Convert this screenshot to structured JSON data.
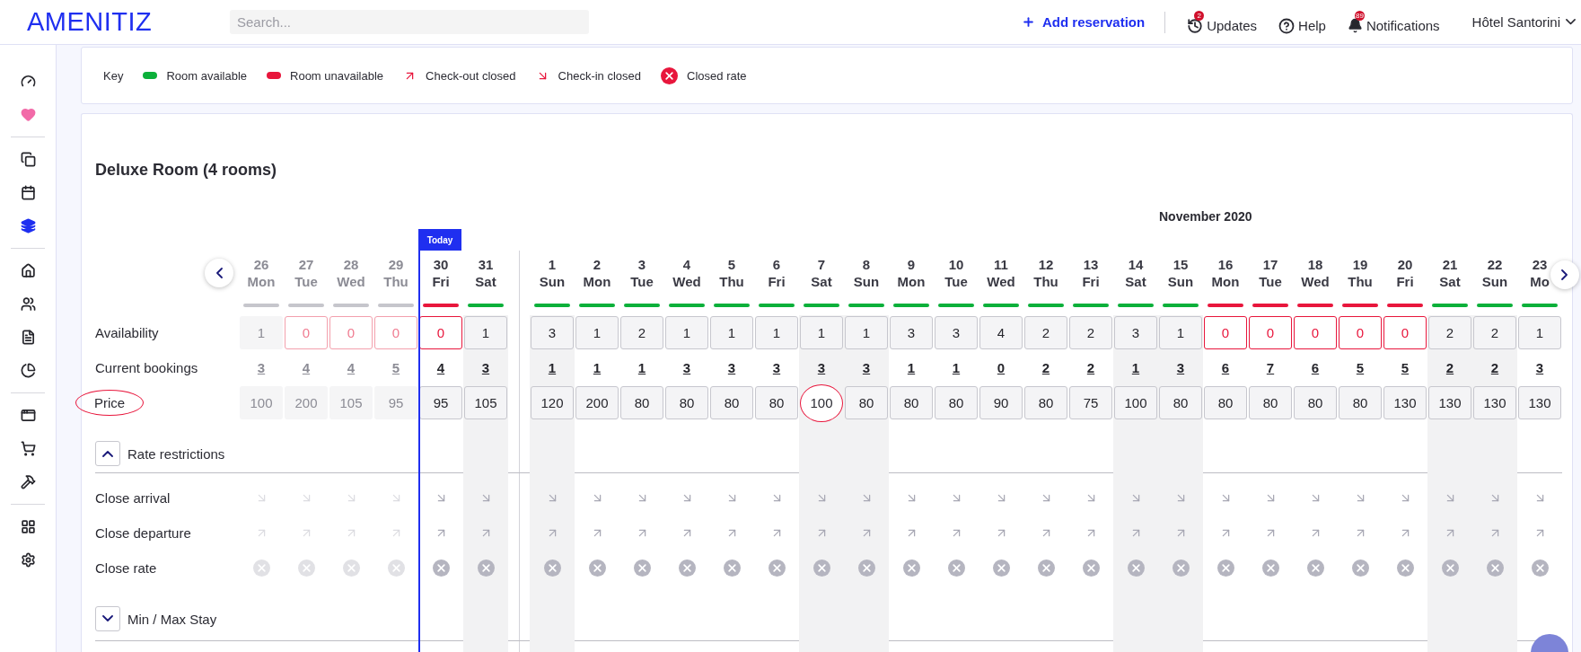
{
  "header": {
    "logo": "AMENITIZ",
    "search": {
      "placeholder": "Search..."
    },
    "add_reservation": "Add reservation",
    "nav": [
      {
        "kind": "updates",
        "label": "Updates",
        "badge": "2"
      },
      {
        "kind": "help",
        "label": "Help"
      },
      {
        "kind": "notifications",
        "label": "Notifications",
        "badge": "89"
      }
    ],
    "hotel": "Hôtel Santorini"
  },
  "sidebar": {
    "groups": [
      [
        {
          "kind": "dashboard",
          "selected": false
        },
        {
          "kind": "heart",
          "selected": false
        }
      ],
      [
        {
          "kind": "copy",
          "selected": false
        },
        {
          "kind": "calendar",
          "selected": false
        },
        {
          "kind": "layers",
          "selected": true
        }
      ],
      [
        {
          "kind": "home",
          "selected": false
        },
        {
          "kind": "users",
          "selected": false
        },
        {
          "kind": "file",
          "selected": false
        },
        {
          "kind": "pie",
          "selected": false
        }
      ],
      [
        {
          "kind": "window",
          "selected": false
        },
        {
          "kind": "cart",
          "selected": false
        },
        {
          "kind": "tool",
          "selected": false
        }
      ],
      [
        {
          "kind": "apps",
          "selected": false
        },
        {
          "kind": "settings",
          "selected": false
        }
      ]
    ]
  },
  "key": {
    "title": "Key",
    "items": [
      {
        "kind": "available",
        "label": "Room available"
      },
      {
        "kind": "unavailable",
        "label": "Room unavailable"
      },
      {
        "kind": "checkout",
        "label": "Check-out closed"
      },
      {
        "kind": "checkin",
        "label": "Check-in closed"
      },
      {
        "kind": "closed_rate",
        "label": "Closed rate"
      }
    ]
  },
  "room": {
    "title": "Deluxe Room (4 rooms)",
    "month": "November 2020",
    "today_label": "Today",
    "row_labels": {
      "availability": "Availability",
      "bookings": "Current bookings",
      "price": {
        "label": "Price",
        "circled": true
      }
    },
    "days": [
      {
        "date": "26",
        "weekday": "Mon",
        "past": true,
        "today": false,
        "weekend": false,
        "month_start": false,
        "available": true,
        "availability": "1",
        "bookings": "3",
        "price": "100",
        "price_circled": false
      },
      {
        "date": "27",
        "weekday": "Tue",
        "past": true,
        "today": false,
        "weekend": false,
        "month_start": false,
        "available": false,
        "availability": "0",
        "bookings": "4",
        "price": "200",
        "price_circled": false
      },
      {
        "date": "28",
        "weekday": "Wed",
        "past": true,
        "today": false,
        "weekend": false,
        "month_start": false,
        "available": false,
        "availability": "0",
        "bookings": "4",
        "price": "105",
        "price_circled": false
      },
      {
        "date": "29",
        "weekday": "Thu",
        "past": true,
        "today": false,
        "weekend": false,
        "month_start": false,
        "available": false,
        "availability": "0",
        "bookings": "5",
        "price": "95",
        "price_circled": false
      },
      {
        "date": "30",
        "weekday": "Fri",
        "past": false,
        "today": true,
        "weekend": false,
        "month_start": false,
        "available": false,
        "availability": "0",
        "bookings": "4",
        "price": "95",
        "price_circled": false
      },
      {
        "date": "31",
        "weekday": "Sat",
        "past": false,
        "today": false,
        "weekend": true,
        "month_start": false,
        "available": true,
        "availability": "1",
        "bookings": "3",
        "price": "105",
        "price_circled": false
      },
      {
        "date": "1",
        "weekday": "Sun",
        "past": false,
        "today": false,
        "weekend": true,
        "month_start": true,
        "available": true,
        "availability": "3",
        "bookings": "1",
        "price": "120",
        "price_circled": false
      },
      {
        "date": "2",
        "weekday": "Mon",
        "past": false,
        "today": false,
        "weekend": false,
        "month_start": false,
        "available": true,
        "availability": "1",
        "bookings": "1",
        "price": "200",
        "price_circled": false
      },
      {
        "date": "3",
        "weekday": "Tue",
        "past": false,
        "today": false,
        "weekend": false,
        "month_start": false,
        "available": true,
        "availability": "2",
        "bookings": "1",
        "price": "80",
        "price_circled": false
      },
      {
        "date": "4",
        "weekday": "Wed",
        "past": false,
        "today": false,
        "weekend": false,
        "month_start": false,
        "available": true,
        "availability": "1",
        "bookings": "3",
        "price": "80",
        "price_circled": false
      },
      {
        "date": "5",
        "weekday": "Thu",
        "past": false,
        "today": false,
        "weekend": false,
        "month_start": false,
        "available": true,
        "availability": "1",
        "bookings": "3",
        "price": "80",
        "price_circled": false
      },
      {
        "date": "6",
        "weekday": "Fri",
        "past": false,
        "today": false,
        "weekend": false,
        "month_start": false,
        "available": true,
        "availability": "1",
        "bookings": "3",
        "price": "80",
        "price_circled": false
      },
      {
        "date": "7",
        "weekday": "Sat",
        "past": false,
        "today": false,
        "weekend": true,
        "month_start": false,
        "available": true,
        "availability": "1",
        "bookings": "3",
        "price": "100",
        "price_circled": true
      },
      {
        "date": "8",
        "weekday": "Sun",
        "past": false,
        "today": false,
        "weekend": true,
        "month_start": false,
        "available": true,
        "availability": "1",
        "bookings": "3",
        "price": "80",
        "price_circled": false
      },
      {
        "date": "9",
        "weekday": "Mon",
        "past": false,
        "today": false,
        "weekend": false,
        "month_start": false,
        "available": true,
        "availability": "3",
        "bookings": "1",
        "price": "80",
        "price_circled": false
      },
      {
        "date": "10",
        "weekday": "Tue",
        "past": false,
        "today": false,
        "weekend": false,
        "month_start": false,
        "available": true,
        "availability": "3",
        "bookings": "1",
        "price": "80",
        "price_circled": false
      },
      {
        "date": "11",
        "weekday": "Wed",
        "past": false,
        "today": false,
        "weekend": false,
        "month_start": false,
        "available": true,
        "availability": "4",
        "bookings": "0",
        "price": "90",
        "price_circled": false
      },
      {
        "date": "12",
        "weekday": "Thu",
        "past": false,
        "today": false,
        "weekend": false,
        "month_start": false,
        "available": true,
        "availability": "2",
        "bookings": "2",
        "price": "80",
        "price_circled": false
      },
      {
        "date": "13",
        "weekday": "Fri",
        "past": false,
        "today": false,
        "weekend": false,
        "month_start": false,
        "available": true,
        "availability": "2",
        "bookings": "2",
        "price": "75",
        "price_circled": false
      },
      {
        "date": "14",
        "weekday": "Sat",
        "past": false,
        "today": false,
        "weekend": true,
        "month_start": false,
        "available": true,
        "availability": "3",
        "bookings": "1",
        "price": "100",
        "price_circled": false
      },
      {
        "date": "15",
        "weekday": "Sun",
        "past": false,
        "today": false,
        "weekend": true,
        "month_start": false,
        "available": true,
        "availability": "1",
        "bookings": "3",
        "price": "80",
        "price_circled": false
      },
      {
        "date": "16",
        "weekday": "Mon",
        "past": false,
        "today": false,
        "weekend": false,
        "month_start": false,
        "available": false,
        "availability": "0",
        "bookings": "6",
        "price": "80",
        "price_circled": false
      },
      {
        "date": "17",
        "weekday": "Tue",
        "past": false,
        "today": false,
        "weekend": false,
        "month_start": false,
        "available": false,
        "availability": "0",
        "bookings": "7",
        "price": "80",
        "price_circled": false
      },
      {
        "date": "18",
        "weekday": "Wed",
        "past": false,
        "today": false,
        "weekend": false,
        "month_start": false,
        "available": false,
        "availability": "0",
        "bookings": "6",
        "price": "80",
        "price_circled": false
      },
      {
        "date": "19",
        "weekday": "Thu",
        "past": false,
        "today": false,
        "weekend": false,
        "month_start": false,
        "available": false,
        "availability": "0",
        "bookings": "5",
        "price": "80",
        "price_circled": false
      },
      {
        "date": "20",
        "weekday": "Fri",
        "past": false,
        "today": false,
        "weekend": false,
        "month_start": false,
        "available": false,
        "availability": "0",
        "bookings": "5",
        "price": "130",
        "price_circled": false
      },
      {
        "date": "21",
        "weekday": "Sat",
        "past": false,
        "today": false,
        "weekend": true,
        "month_start": false,
        "available": true,
        "availability": "2",
        "bookings": "2",
        "price": "130",
        "price_circled": false
      },
      {
        "date": "22",
        "weekday": "Sun",
        "past": false,
        "today": false,
        "weekend": true,
        "month_start": false,
        "available": true,
        "availability": "2",
        "bookings": "2",
        "price": "130",
        "price_circled": false
      },
      {
        "date": "23",
        "weekday": "Mo",
        "past": false,
        "today": false,
        "weekend": false,
        "month_start": false,
        "available": true,
        "availability": "1",
        "bookings": "3",
        "price": "130",
        "price_circled": false
      }
    ],
    "sections": [
      {
        "title": "Rate restrictions",
        "expanded": true,
        "rows": [
          {
            "kind": "close_arrival",
            "label": "Close arrival"
          },
          {
            "kind": "close_departure",
            "label": "Close departure"
          },
          {
            "kind": "close_rate",
            "label": "Close rate"
          }
        ]
      },
      {
        "title": "Min / Max Stay",
        "expanded": false
      }
    ]
  }
}
